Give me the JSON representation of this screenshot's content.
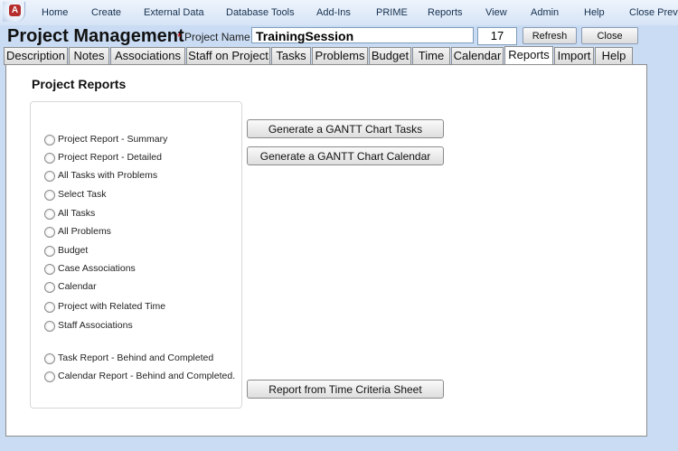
{
  "ribbon": {
    "menu": [
      "Home",
      "Create",
      "External Data",
      "Database Tools",
      "Add-Ins",
      "PRIME",
      "Reports",
      "View",
      "Admin",
      "Help",
      "Close Previ"
    ]
  },
  "header": {
    "title": "Project Management",
    "project_name_star": "*",
    "project_name_label": "Project Name",
    "project_name_value": "TrainingSession",
    "project_id": "17",
    "refresh_label": "Refresh",
    "close_label": "Close"
  },
  "tabs": [
    "Description",
    "Notes",
    "Associations",
    "Staff on Project",
    "Tasks",
    "Problems",
    "Budget",
    "Time",
    "Calendar",
    "Reports",
    "Import",
    "Help"
  ],
  "active_tab": "Reports",
  "reports": {
    "title": "Project Reports",
    "options": [
      "Project Report - Summary",
      "Project Report - Detailed",
      "All Tasks with Problems",
      "Select Task",
      "All Tasks",
      "All Problems",
      "Budget",
      "Case Associations",
      "Calendar",
      "Project with Related Time",
      "Staff Associations",
      "Task Report - Behind and Completed",
      "Calendar Report - Behind and Completed."
    ],
    "buttons": {
      "gantt_tasks": "Generate a GANTT Chart Tasks",
      "gantt_calendar": "Generate a GANTT Chart Calendar",
      "time_criteria": "Report from Time Criteria Sheet"
    }
  }
}
